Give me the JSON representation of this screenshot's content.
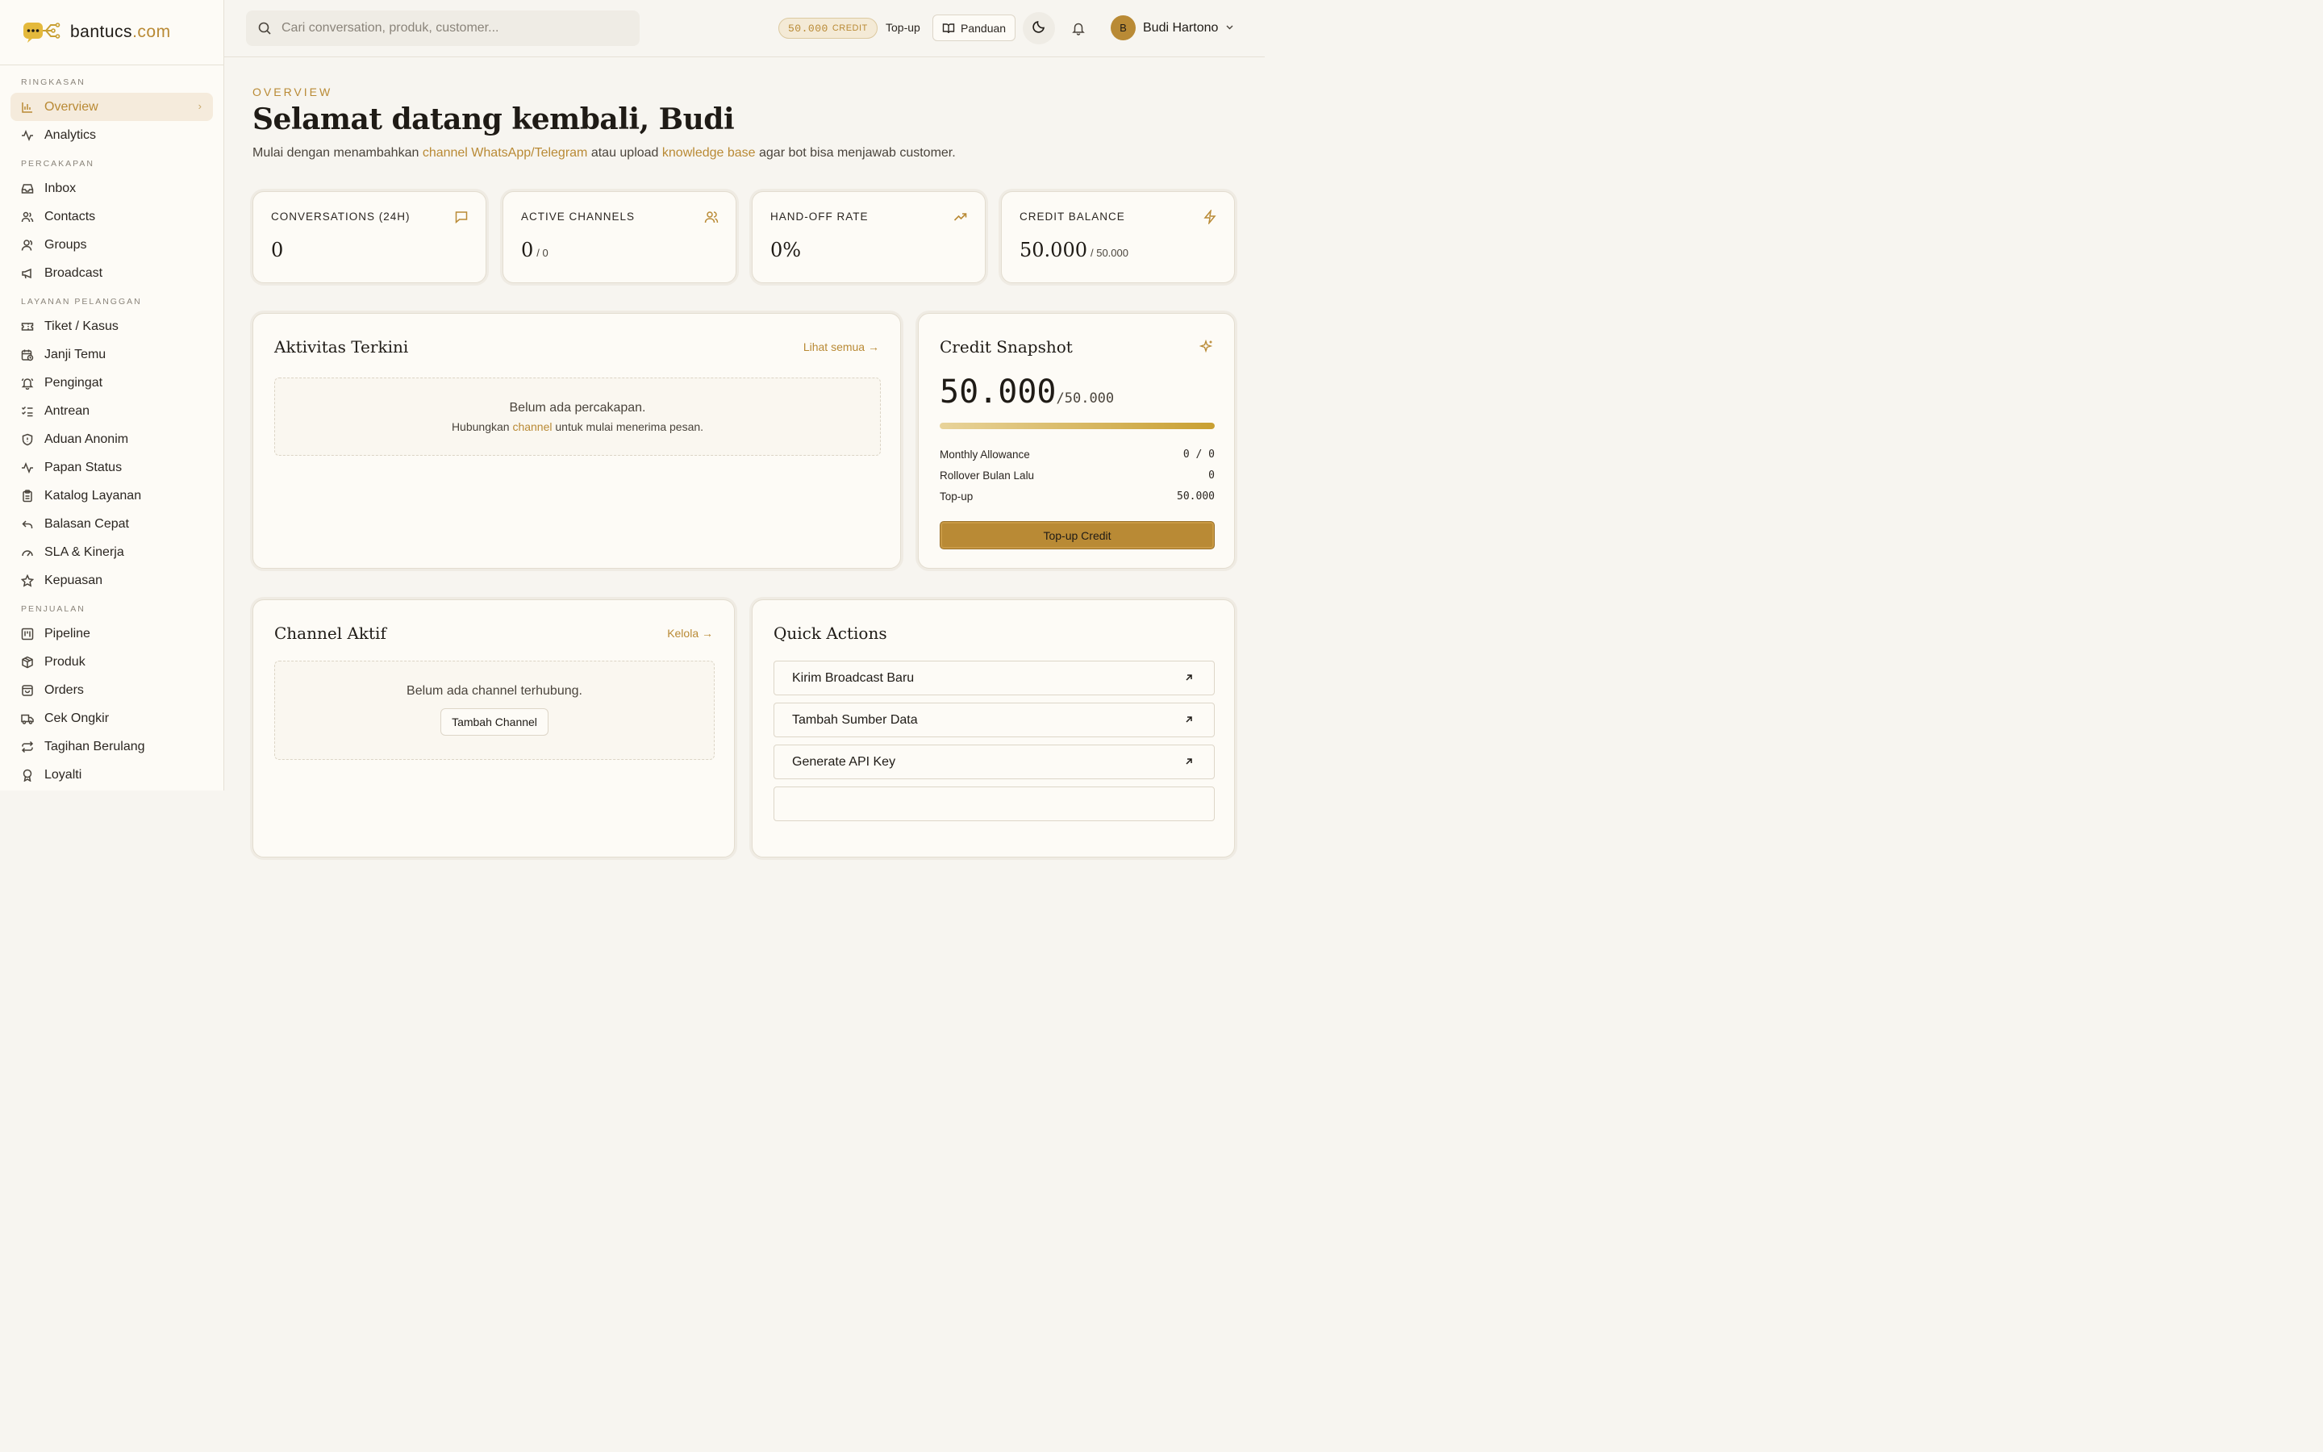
{
  "brand": {
    "name": "bantucs",
    "tld": ".com"
  },
  "sidebar": {
    "sections": [
      {
        "title": "RINGKASAN",
        "items": [
          {
            "label": "Overview",
            "icon": "bar-chart-icon",
            "active": true
          },
          {
            "label": "Analytics",
            "icon": "activity-icon"
          }
        ]
      },
      {
        "title": "PERCAKAPAN",
        "items": [
          {
            "label": "Inbox",
            "icon": "inbox-icon"
          },
          {
            "label": "Contacts",
            "icon": "users-icon"
          },
          {
            "label": "Groups",
            "icon": "group-icon"
          },
          {
            "label": "Broadcast",
            "icon": "megaphone-icon"
          }
        ]
      },
      {
        "title": "LAYANAN PELANGGAN",
        "items": [
          {
            "label": "Tiket / Kasus",
            "icon": "ticket-icon"
          },
          {
            "label": "Janji Temu",
            "icon": "calendar-clock-icon"
          },
          {
            "label": "Pengingat",
            "icon": "bell-ring-icon"
          },
          {
            "label": "Antrean",
            "icon": "list-checks-icon"
          },
          {
            "label": "Aduan Anonim",
            "icon": "shield-icon"
          },
          {
            "label": "Papan Status",
            "icon": "activity-icon"
          },
          {
            "label": "Katalog Layanan",
            "icon": "clipboard-icon"
          },
          {
            "label": "Balasan Cepat",
            "icon": "reply-icon"
          },
          {
            "label": "SLA & Kinerja",
            "icon": "gauge-icon"
          },
          {
            "label": "Kepuasan",
            "icon": "star-icon"
          }
        ]
      },
      {
        "title": "PENJUALAN",
        "items": [
          {
            "label": "Pipeline",
            "icon": "kanban-icon"
          },
          {
            "label": "Produk",
            "icon": "package-icon"
          },
          {
            "label": "Orders",
            "icon": "shopping-bag-icon"
          },
          {
            "label": "Cek Ongkir",
            "icon": "truck-icon"
          },
          {
            "label": "Tagihan Berulang",
            "icon": "repeat-icon"
          },
          {
            "label": "Loyalti",
            "icon": "award-icon"
          }
        ]
      }
    ]
  },
  "topbar": {
    "search_placeholder": "Cari conversation, produk, customer...",
    "credit_value": "50.000",
    "credit_unit": "CREDIT",
    "topup_label": "Top-up",
    "guide_label": "Panduan",
    "user_initial": "B",
    "user_name": "Budi Hartono"
  },
  "header": {
    "eyebrow": "OVERVIEW",
    "title": "Selamat datang kembali, Budi",
    "sub_1": "Mulai dengan menambahkan ",
    "sub_link_1": "channel WhatsApp/Telegram",
    "sub_2": " atau upload ",
    "sub_link_2": "knowledge base",
    "sub_3": " agar bot bisa menjawab customer."
  },
  "stats": [
    {
      "label": "CONVERSATIONS (24H)",
      "value": "0",
      "of": "",
      "icon": "message-square-icon"
    },
    {
      "label": "ACTIVE CHANNELS",
      "value": "0",
      "of": "/ 0",
      "icon": "users-icon"
    },
    {
      "label": "HAND-OFF RATE",
      "value": "0%",
      "of": "",
      "icon": "trending-up-icon"
    },
    {
      "label": "CREDIT BALANCE",
      "value": "50.000",
      "of": "/ 50.000",
      "icon": "zap-icon"
    }
  ],
  "activity": {
    "title": "Aktivitas Terkini",
    "link": "Lihat semua →",
    "empty_main": "Belum ada percakapan.",
    "empty_sub_1": "Hubungkan ",
    "empty_sub_link": "channel",
    "empty_sub_2": " untuk mulai menerima pesan."
  },
  "snapshot": {
    "title": "Credit Snapshot",
    "value": "50.000",
    "of": "/50.000",
    "progress": 1.0,
    "rows": [
      {
        "label": "Monthly Allowance",
        "value": "0 / 0"
      },
      {
        "label": "Rollover Bulan Lalu",
        "value": "0"
      },
      {
        "label": "Top-up",
        "value": "50.000"
      }
    ],
    "button": "Top-up Credit"
  },
  "channels": {
    "title": "Channel Aktif",
    "link": "Kelola →",
    "empty_main": "Belum ada channel terhubung.",
    "button": "Tambah Channel"
  },
  "quick_actions": {
    "title": "Quick Actions",
    "items": [
      "Kirim Broadcast Baru",
      "Tambah Sumber Data",
      "Generate API Key"
    ]
  },
  "colors": {
    "accent": "#b98a35",
    "background": "#f7f5f0",
    "card": "#fdfbf6"
  }
}
